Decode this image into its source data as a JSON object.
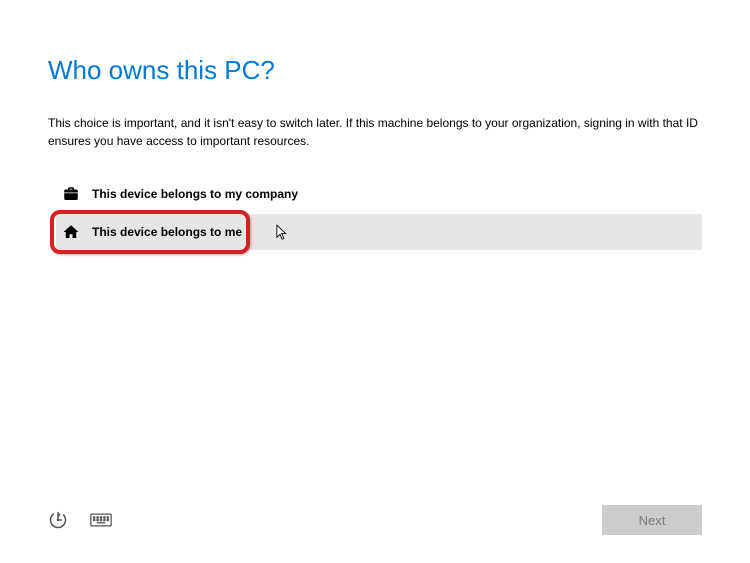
{
  "title": "Who owns this PC?",
  "description": "This choice is important, and it isn't easy to switch later. If this machine belongs to your organization, signing in with that ID ensures you have access to important resources.",
  "options": {
    "company": {
      "label": "This device belongs to my company"
    },
    "personal": {
      "label": "This device belongs to me"
    }
  },
  "footer": {
    "next_label": "Next"
  }
}
